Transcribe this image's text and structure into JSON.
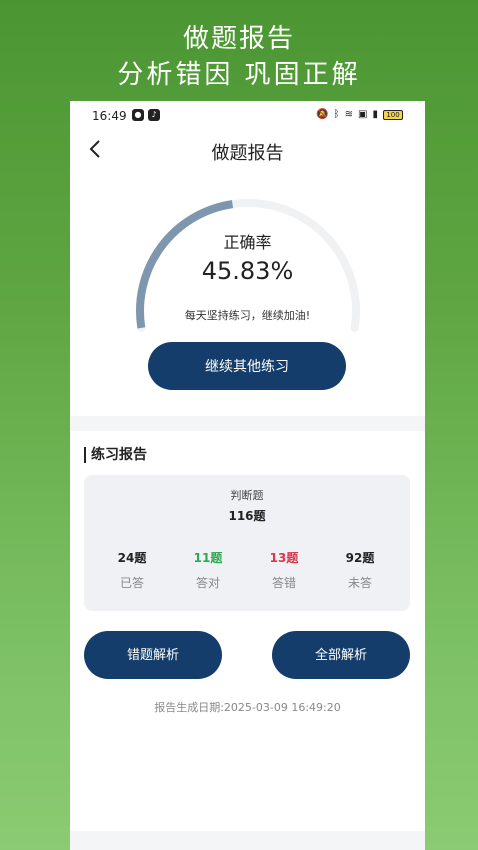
{
  "promo": {
    "line1": "做题报告",
    "line2": "分析错因  巩固正解"
  },
  "statusbar": {
    "time": "16:49",
    "battery": "100"
  },
  "header": {
    "title": "做题报告"
  },
  "summary": {
    "accuracy_label": "正确率",
    "accuracy_value": "45.83%",
    "accuracy_fraction": 0.4583,
    "motto": "每天坚持练习，继续加油!",
    "continue_label": "继续其他练习"
  },
  "report": {
    "section_title": "练习报告",
    "question_type": "判断题",
    "total": "116题",
    "stats": [
      {
        "value": "24题",
        "label": "已答",
        "color": "#222222"
      },
      {
        "value": "11题",
        "label": "答对",
        "color": "#2fa84f"
      },
      {
        "value": "13题",
        "label": "答错",
        "color": "#d9374b"
      },
      {
        "value": "92题",
        "label": "未答",
        "color": "#222222"
      }
    ],
    "wrong_analysis_label": "错题解析",
    "all_analysis_label": "全部解析",
    "generated_date": "报告生成日期:2025-03-09 16:49:20"
  },
  "colors": {
    "accent": "#143d6b",
    "gauge_fill": "#7f97ae",
    "gauge_track": "#f0f1f3"
  }
}
